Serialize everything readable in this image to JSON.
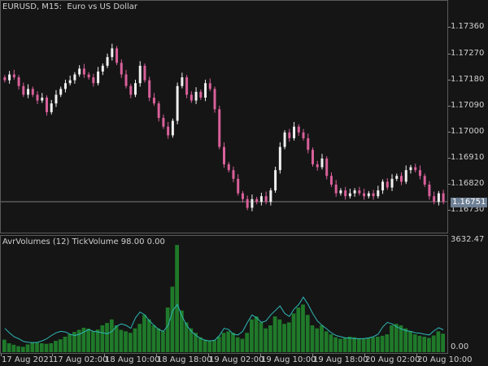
{
  "main_title": "EURUSD, M15:  Euro vs US Dollar",
  "sub_title": "AvrVolumes (12) TickVolume 98.00 0.00",
  "current_price": "1.16751",
  "price_axis": [
    "1.17360",
    "1.17270",
    "1.17180",
    "1.17090",
    "1.17000",
    "1.16910",
    "1.16820",
    "1.16730"
  ],
  "volume_axis": {
    "top": "3632.47",
    "bottom": "0.00"
  },
  "time_axis": [
    "17 Aug 2021",
    "17 Aug 02:00",
    "18 Aug 10:00",
    "18 Aug 18:00",
    "19 Aug 02:00",
    "19 Aug 10:00",
    "19 Aug 18:00",
    "20 Aug 02:00",
    "20 Aug 10:00"
  ],
  "colors": {
    "background": "#151515",
    "bull": "#f0f0f0",
    "bear": "#d8609a",
    "volume": "#1f7a2a",
    "average": "#2fb8b8",
    "grid": "#5a5a5a",
    "price_line": "#7a7a7a"
  },
  "chart_data": [
    {
      "type": "candlestick",
      "title": "EURUSD, M15:  Euro vs US Dollar",
      "ylim": [
        1.1665,
        1.1743
      ],
      "current_price": 1.16751,
      "x_labels": [
        "17 Aug 2021",
        "17 Aug 02:00",
        "18 Aug 10:00",
        "18 Aug 18:00",
        "19 Aug 02:00",
        "19 Aug 10:00",
        "19 Aug 18:00",
        "20 Aug 02:00",
        "20 Aug 10:00"
      ],
      "close": [
        1.1717,
        1.1719,
        1.1718,
        1.1715,
        1.1712,
        1.1714,
        1.1712,
        1.171,
        1.1711,
        1.1706,
        1.1709,
        1.1712,
        1.1714,
        1.1716,
        1.1717,
        1.1719,
        1.1721,
        1.1719,
        1.1718,
        1.1716,
        1.172,
        1.1722,
        1.1725,
        1.1728,
        1.1723,
        1.1719,
        1.1715,
        1.1712,
        1.1716,
        1.1722,
        1.1717,
        1.1711,
        1.1709,
        1.1704,
        1.1701,
        1.1698,
        1.1703,
        1.1715,
        1.1718,
        1.1712,
        1.171,
        1.1713,
        1.1711,
        1.1716,
        1.1714,
        1.1707,
        1.1694,
        1.1688,
        1.1686,
        1.1683,
        1.1678,
        1.1676,
        1.1673,
        1.1676,
        1.1675,
        1.1677,
        1.1675,
        1.1679,
        1.1686,
        1.1694,
        1.1699,
        1.1697,
        1.1701,
        1.1699,
        1.1697,
        1.1693,
        1.1688,
        1.1687,
        1.169,
        1.1684,
        1.1681,
        1.1678,
        1.1679,
        1.1677,
        1.1678,
        1.1679,
        1.1678,
        1.1677,
        1.1678,
        1.1677,
        1.1679,
        1.1682,
        1.168,
        1.1683,
        1.1684,
        1.1682,
        1.1686,
        1.1687,
        1.1686,
        1.1684,
        1.1681,
        1.1677,
        1.1675,
        1.1678,
        1.1675
      ]
    },
    {
      "type": "bar",
      "title": "AvrVolumes (12) TickVolume 98.00 0.00",
      "ylim": [
        0,
        3632.47
      ],
      "values": [
        420,
        300,
        250,
        200,
        180,
        260,
        330,
        320,
        300,
        280,
        300,
        380,
        430,
        520,
        600,
        680,
        750,
        820,
        790,
        700,
        760,
        900,
        980,
        1100,
        900,
        750,
        700,
        650,
        800,
        950,
        1250,
        1100,
        900,
        800,
        700,
        1500,
        2200,
        3600,
        1400,
        1000,
        800,
        650,
        500,
        420,
        380,
        400,
        520,
        650,
        700,
        650,
        500,
        450,
        650,
        1100,
        1200,
        1000,
        800,
        900,
        1200,
        1100,
        950,
        1000,
        1300,
        1500,
        1600,
        1250,
        900,
        800,
        900,
        700,
        600,
        500,
        450,
        480,
        520,
        500,
        470,
        460,
        480,
        500,
        520,
        550,
        600,
        900,
        950,
        900,
        800,
        700,
        600,
        550,
        520,
        480,
        560,
        700,
        620
      ],
      "average": [
        800,
        650,
        520,
        450,
        360,
        330,
        320,
        330,
        380,
        450,
        560,
        650,
        700,
        680,
        600,
        560,
        600,
        680,
        760,
        700,
        680,
        650,
        620,
        700,
        880,
        950,
        900,
        800,
        1150,
        1350,
        1250,
        1050,
        900,
        760,
        700,
        900,
        1400,
        1600,
        1200,
        900,
        700,
        560,
        460,
        400,
        380,
        400,
        560,
        800,
        760,
        600,
        580,
        700,
        1000,
        1250,
        1150,
        1000,
        1050,
        1250,
        1400,
        1550,
        1300,
        1200,
        1450,
        1600,
        1850,
        1600,
        1300,
        1050,
        900,
        780,
        650,
        560,
        520,
        480,
        470,
        460,
        450,
        460,
        480,
        520,
        600,
        850,
        1000,
        950,
        850,
        780,
        720,
        700,
        650,
        640,
        600,
        580,
        720,
        820,
        750
      ]
    }
  ]
}
